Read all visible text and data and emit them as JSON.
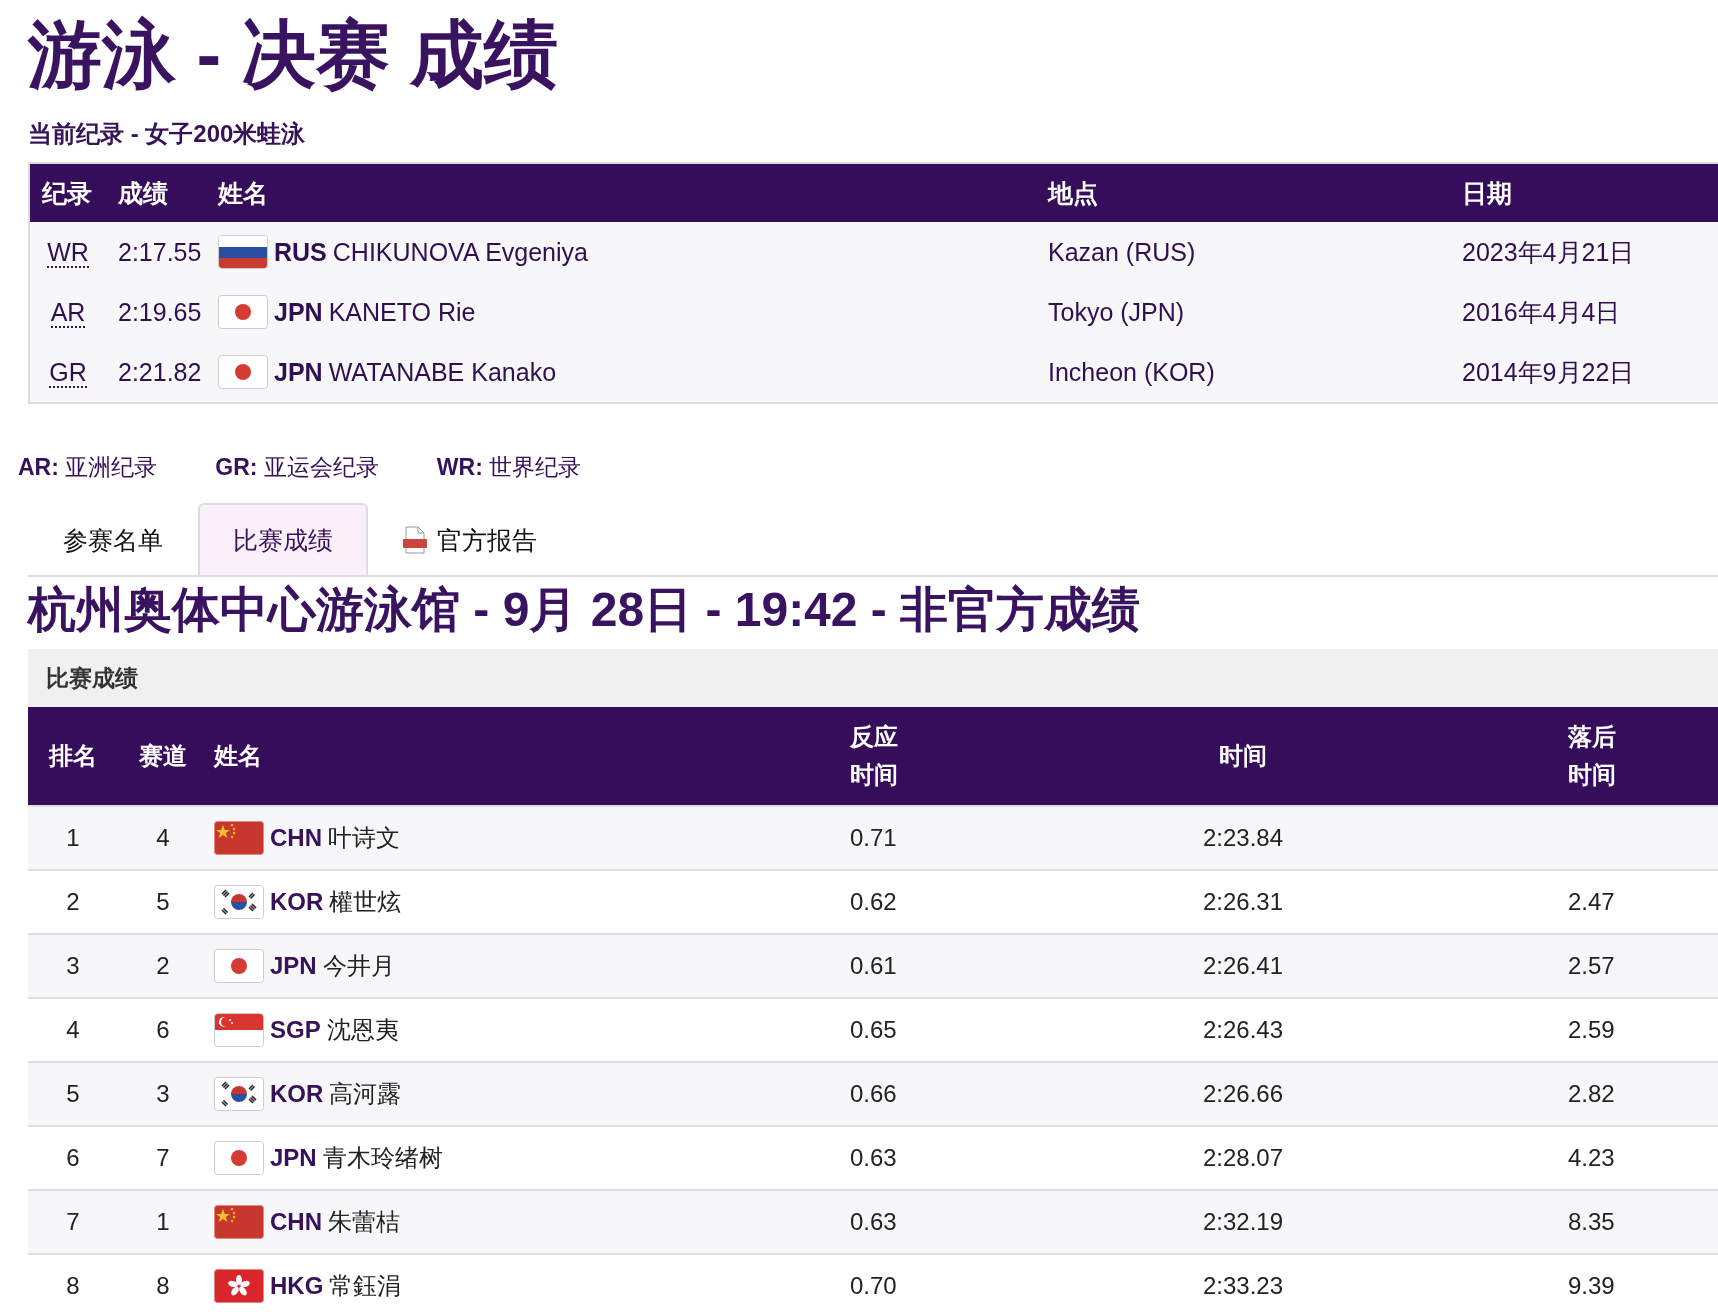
{
  "page_title": "游泳 - 决赛 成绩",
  "records": {
    "title": "当前纪录 - 女子200米蛙泳",
    "columns": [
      "纪录",
      "成绩",
      "姓名",
      "地点",
      "日期"
    ],
    "rows": [
      {
        "record": "WR",
        "result": "2:17.55",
        "kind": "rus",
        "noc": "RUS",
        "name": "CHIKUNOVA Evgeniya",
        "place": "Kazan (RUS)",
        "date": "2023年4月21日"
      },
      {
        "record": "AR",
        "result": "2:19.65",
        "kind": "jpn",
        "noc": "JPN",
        "name": "KANETO Rie",
        "place": "Tokyo (JPN)",
        "date": "2016年4月4日"
      },
      {
        "record": "GR",
        "result": "2:21.82",
        "kind": "jpn",
        "noc": "JPN",
        "name": "WATANABE Kanako",
        "place": "Incheon (KOR)",
        "date": "2014年9月22日"
      }
    ]
  },
  "legend": [
    "**AR:** 亚洲纪录",
    "**GR:** 亚运会纪录",
    "**WR:** 世界纪录"
  ],
  "tabs": [
    {
      "label": "参赛名单",
      "selected": false
    },
    {
      "label": "比赛成绩",
      "selected": true
    },
    {
      "label": "官方报告",
      "selected": false,
      "kind": "pdf"
    }
  ],
  "heading": "杭州奥体中心游泳馆 - 9月 28日 - 19:42 - 非官方成绩",
  "results": {
    "title": "比赛成绩",
    "columns": [
      "排名",
      "赛道",
      "姓名",
      "反应时间",
      "时间",
      "落后时间"
    ],
    "rows": [
      {
        "rank": "1",
        "lane": "4",
        "kind": "chn",
        "noc": "CHN",
        "name": "叶诗文",
        "reaction": "0.71",
        "time": "2:23.84"
      },
      {
        "rank": "2",
        "lane": "5",
        "kind": "kor",
        "noc": "KOR",
        "name": "權世炫",
        "reaction": "0.62",
        "time": "2:26.31",
        "behind": "2.47"
      },
      {
        "rank": "3",
        "lane": "2",
        "kind": "jpn",
        "noc": "JPN",
        "name": "今井月",
        "reaction": "0.61",
        "time": "2:26.41",
        "behind": "2.57"
      },
      {
        "rank": "4",
        "lane": "6",
        "kind": "sgp",
        "noc": "SGP",
        "name": "沈恩夷",
        "reaction": "0.65",
        "time": "2:26.43",
        "behind": "2.59"
      },
      {
        "rank": "5",
        "lane": "3",
        "kind": "kor",
        "noc": "KOR",
        "name": "高河露",
        "reaction": "0.66",
        "time": "2:26.66",
        "behind": "2.82"
      },
      {
        "rank": "6",
        "lane": "7",
        "kind": "jpn",
        "noc": "JPN",
        "name": "青木玲绪树",
        "reaction": "0.63",
        "time": "2:28.07",
        "behind": "4.23"
      },
      {
        "rank": "7",
        "lane": "1",
        "kind": "chn",
        "noc": "CHN",
        "name": "朱蕾桔",
        "reaction": "0.63",
        "time": "2:32.19",
        "behind": "8.35"
      },
      {
        "rank": "8",
        "lane": "8",
        "kind": "hkg",
        "noc": "HKG",
        "name": "常鈺涓",
        "reaction": "0.70",
        "time": "2:33.23",
        "behind": "9.39"
      }
    ]
  }
}
